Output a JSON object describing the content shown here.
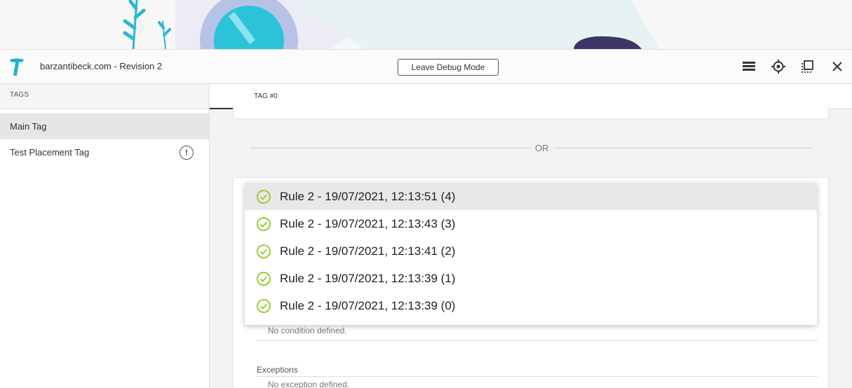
{
  "header": {
    "site_title": "barzantibeck.com - Revision 2",
    "debug_button": "Leave Debug Mode",
    "icons": [
      "list-icon",
      "target-icon",
      "copy-window-icon",
      "close-icon"
    ]
  },
  "sidebar": {
    "heading": "TAGS",
    "items": [
      {
        "label": "Main Tag",
        "active": true
      },
      {
        "label": "Test Placement Tag",
        "warning": true
      }
    ]
  },
  "main": {
    "tab_label": "TAG #0",
    "or_text": "OR",
    "conditions_empty": "No condition defined.",
    "exceptions_label": "Exceptions",
    "exceptions_empty": "No exception defined."
  },
  "dropdown": {
    "items": [
      {
        "label": "Rule 2 - 19/07/2021, 12:13:51 (4)",
        "highlighted": true
      },
      {
        "label": "Rule 2 - 19/07/2021, 12:13:43 (3)"
      },
      {
        "label": "Rule 2 - 19/07/2021, 12:13:41 (2)"
      },
      {
        "label": "Rule 2 - 19/07/2021, 12:13:39 (1)"
      },
      {
        "label": "Rule 2 - 19/07/2021, 12:13:39 (0)"
      }
    ]
  },
  "colors": {
    "check_green": "#9acd32",
    "brand_teal": "#1bb4c9"
  }
}
